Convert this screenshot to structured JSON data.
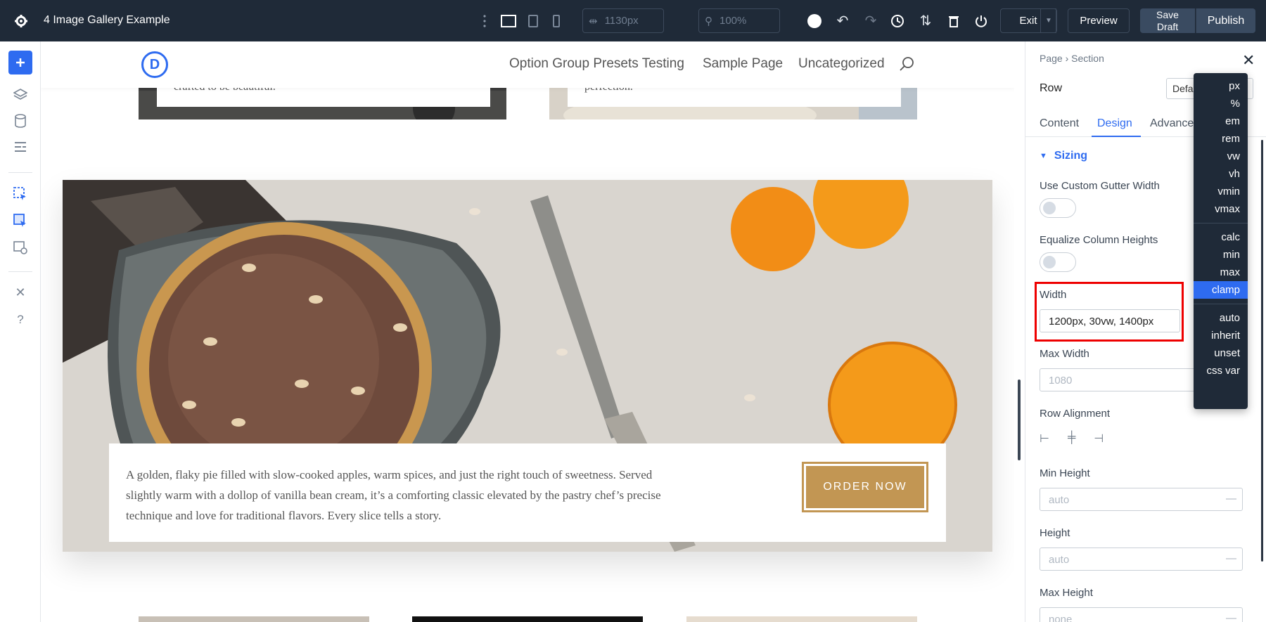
{
  "topbar": {
    "title": "4 Image Gallery Example",
    "width_value": "1130px",
    "zoom_value": "100%",
    "exit_label": "Exit",
    "preview_label": "Preview",
    "save_label_line1": "Save",
    "save_label_line2": "Draft",
    "publish_label": "Publish"
  },
  "site": {
    "logo_letter": "D",
    "nav": [
      "Option Group Presets Testing",
      "Sample Page",
      "Uncategorized"
    ],
    "top_captions": [
      "crafted to be beautiful.",
      "perfection."
    ],
    "hero_text": "A golden, flaky pie filled with slow-cooked apples, warm spices, and just the right touch of sweetness. Served slightly warm with a dollop of vanilla bean cream, it’s a comforting classic elevated by the pastry chef’s precise technique and love for traditional flavors. Every slice tells a story.",
    "order_button": "ORDER NOW"
  },
  "panel": {
    "breadcrumb_page": "Page",
    "breadcrumb_section": "Section",
    "title": "Row",
    "preset_value": "Default",
    "tabs": [
      "Content",
      "Design",
      "Advanced"
    ],
    "active_tab": "Design",
    "group": "Sizing",
    "fields": {
      "custom_gutter": "Use Custom Gutter Width",
      "equalize": "Equalize Column Heights",
      "width_label": "Width",
      "width_value": "1200px, 30vw, 1400px",
      "max_width_label": "Max Width",
      "max_width_placeholder": "1080",
      "row_alignment": "Row Alignment",
      "min_height_label": "Min Height",
      "min_height_placeholder": "auto",
      "height_label": "Height",
      "height_placeholder": "auto",
      "max_height_label": "Max Height",
      "max_height_placeholder": "none"
    }
  },
  "unit_menu": {
    "group1": [
      "px",
      "%",
      "em",
      "rem",
      "vw",
      "vh",
      "vmin",
      "vmax"
    ],
    "group2": [
      "calc",
      "min",
      "max",
      "clamp"
    ],
    "group3": [
      "auto",
      "inherit",
      "unset",
      "css var"
    ],
    "selected": "clamp"
  },
  "colors": {
    "topbar_bg": "#1f2a38",
    "accent": "#2e6bf0",
    "order_gold": "#c29653",
    "highlight_red": "#e00000"
  }
}
